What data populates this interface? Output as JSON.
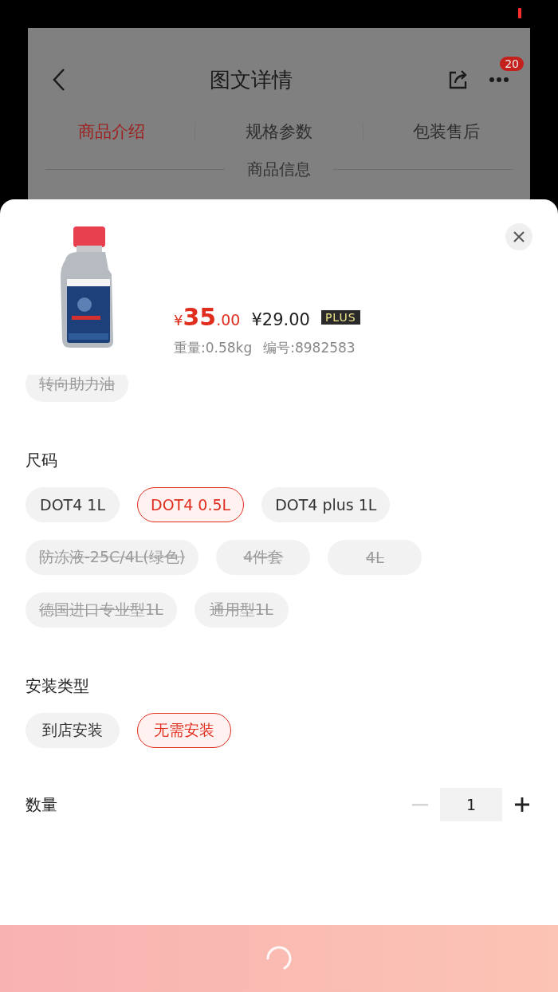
{
  "background_page": {
    "title": "图文详情",
    "more_badge": "20",
    "tabs": [
      {
        "label": "商品介绍",
        "selected": true
      },
      {
        "label": "规格参数",
        "selected": false
      },
      {
        "label": "包装售后",
        "selected": false
      }
    ],
    "section_divider": "商品信息"
  },
  "sheet": {
    "price": {
      "currency": "¥",
      "integer": "35",
      "decimals": ".00"
    },
    "member_price": "¥29.00",
    "member_tag": "PLUS",
    "weight": "重量:0.58kg",
    "code": "编号:8982583",
    "scrolled_options": [
      {
        "label": "转向助力油",
        "disabled": true,
        "selected": false
      }
    ],
    "groups": [
      {
        "title": "尺码",
        "options": [
          {
            "label": "DOT4 1L",
            "disabled": false,
            "selected": false
          },
          {
            "label": "DOT4 0.5L",
            "disabled": false,
            "selected": true
          },
          {
            "label": "DOT4 plus 1L",
            "disabled": false,
            "selected": false
          },
          {
            "label": "防冻液-25C/4L(绿色)",
            "disabled": true,
            "selected": false
          },
          {
            "label": "4件套",
            "disabled": true,
            "selected": false
          },
          {
            "label": "4L",
            "disabled": true,
            "selected": false
          },
          {
            "label": "德国进口专业型1L",
            "disabled": true,
            "selected": false
          },
          {
            "label": "通用型1L",
            "disabled": true,
            "selected": false
          }
        ]
      },
      {
        "title": "安装类型",
        "options": [
          {
            "label": "到店安装",
            "disabled": false,
            "selected": false
          },
          {
            "label": "无需安装",
            "disabled": false,
            "selected": true
          }
        ]
      }
    ],
    "quantity": {
      "label": "数量",
      "value": "1",
      "minus_disabled": true
    },
    "confirm": {
      "loading": true
    }
  }
}
